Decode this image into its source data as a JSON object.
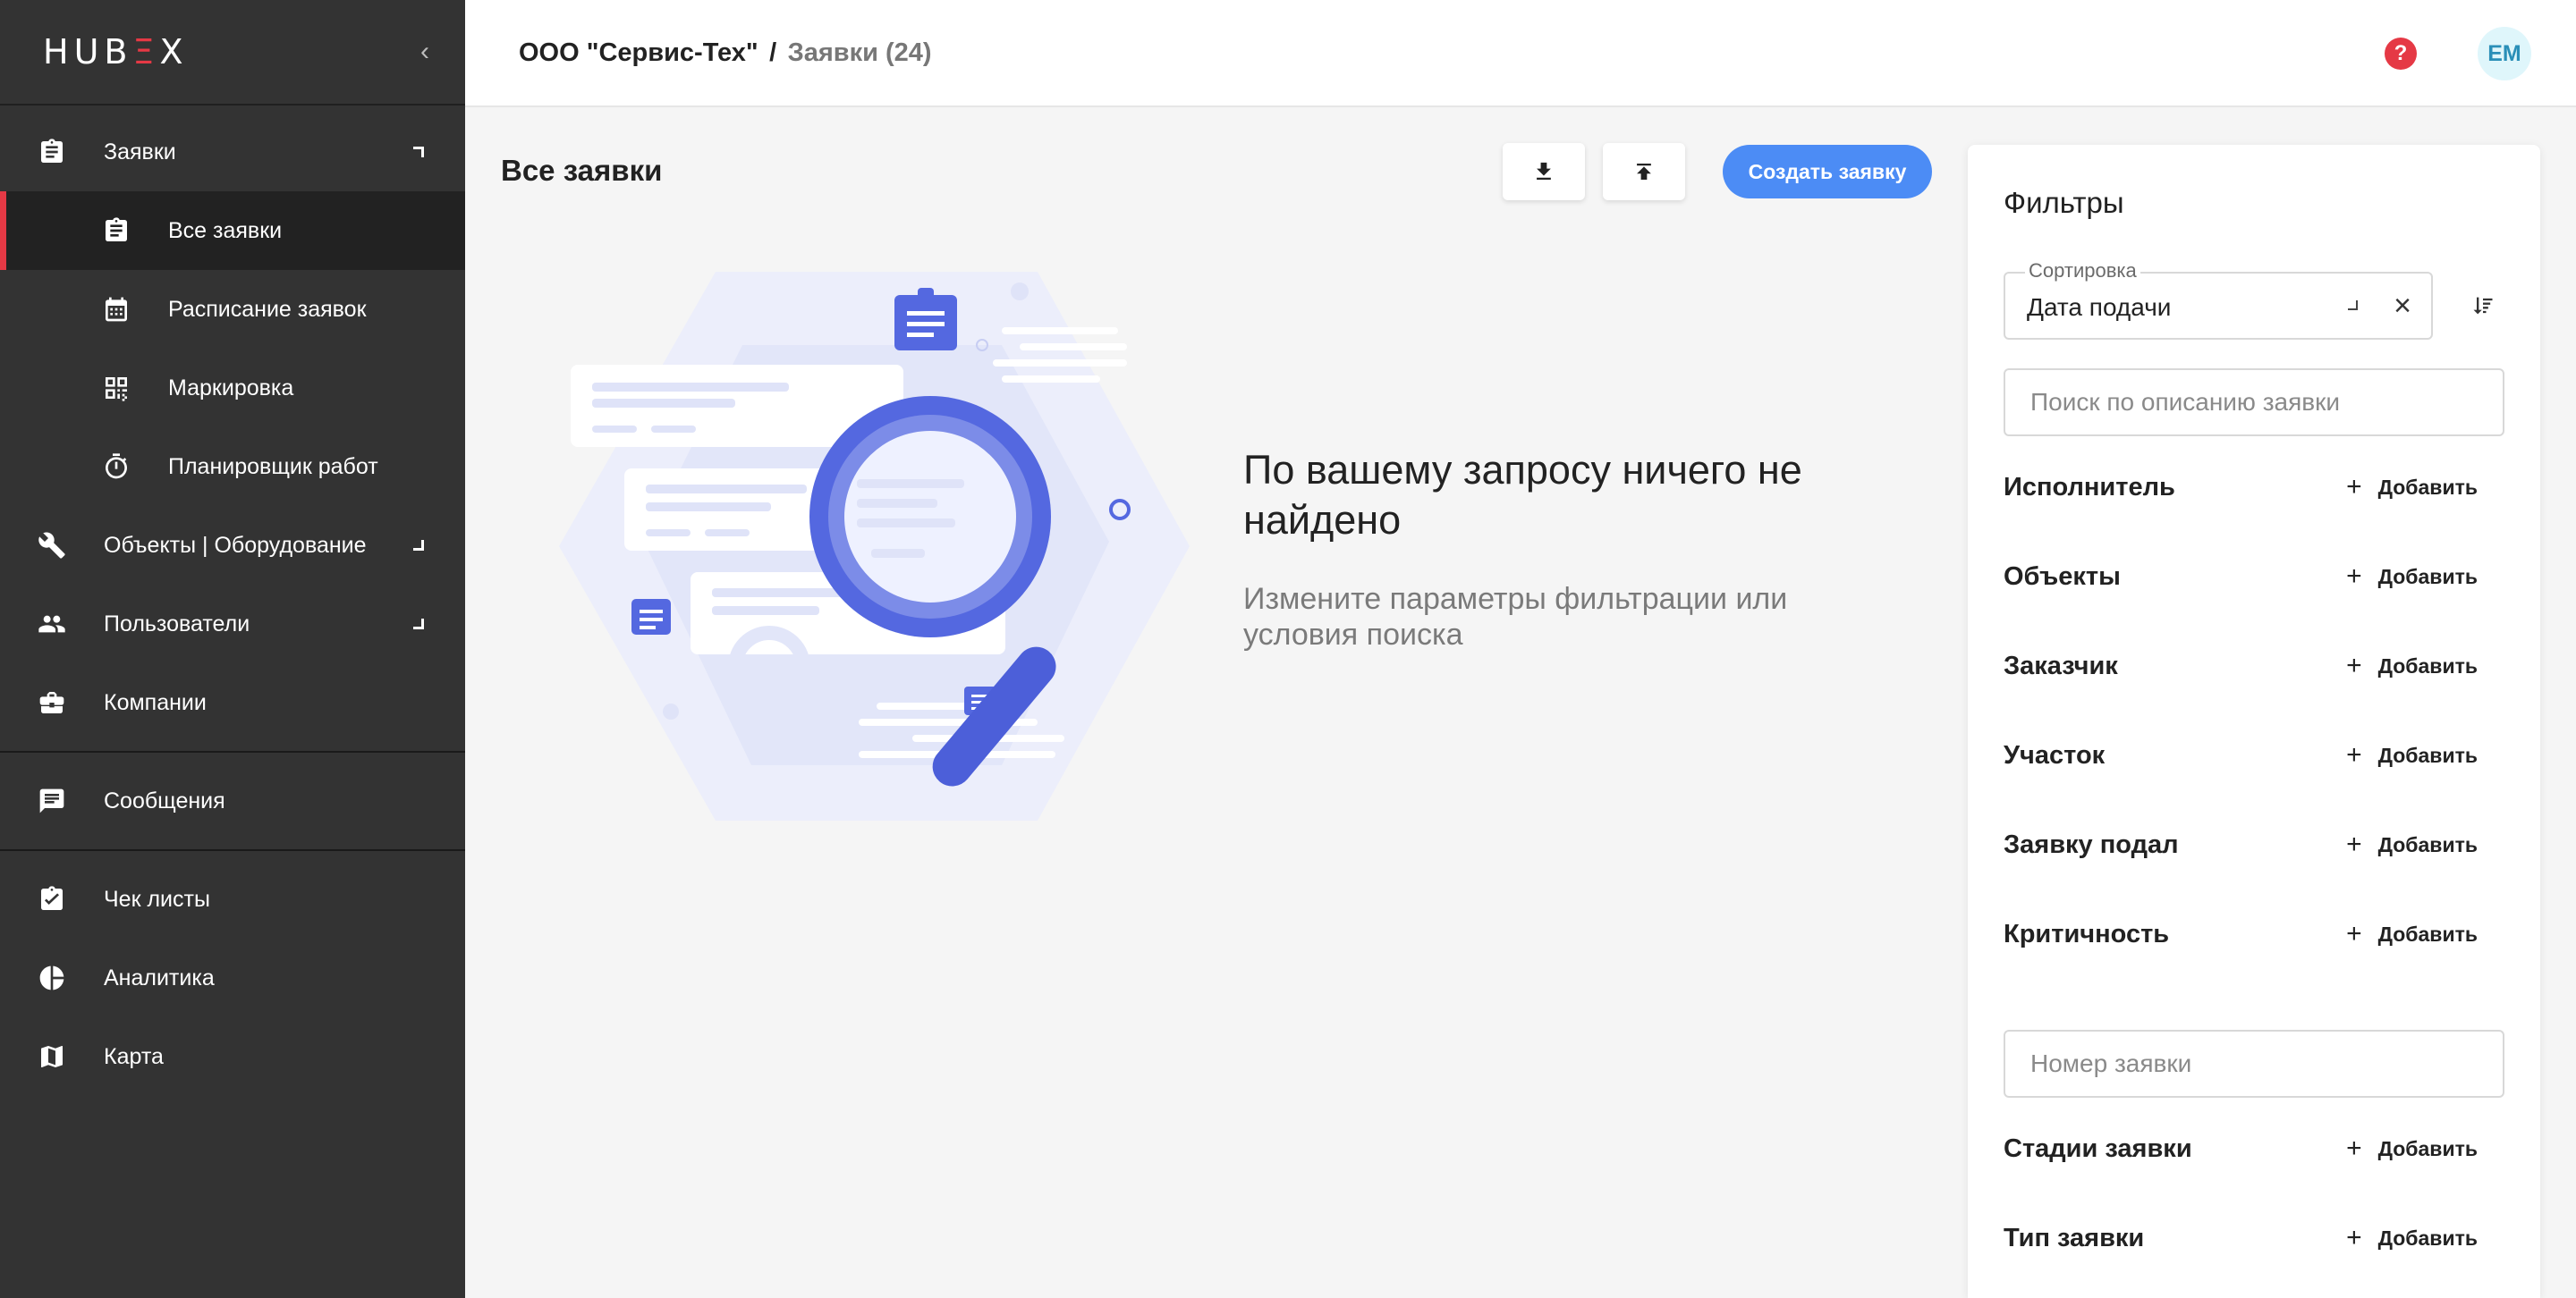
{
  "app": {
    "logo_left": "HUB",
    "logo_accent": "Ξ",
    "logo_right": "X",
    "collapse_icon": "‹"
  },
  "sidebar": {
    "items": [
      {
        "label": "Заявки",
        "icon": "clipboard-icon"
      },
      {
        "label": "Все заявки",
        "icon": "clipboard-icon"
      },
      {
        "label": "Расписание заявок",
        "icon": "calendar-icon"
      },
      {
        "label": "Маркировка",
        "icon": "qr-code-icon"
      },
      {
        "label": "Планировщик работ",
        "icon": "timer-icon"
      },
      {
        "label": "Объекты | Оборудование",
        "icon": "wrench-icon"
      },
      {
        "label": "Пользователи",
        "icon": "users-icon"
      },
      {
        "label": "Компании",
        "icon": "briefcase-icon"
      },
      {
        "label": "Сообщения",
        "icon": "chat-icon"
      },
      {
        "label": "Чек листы",
        "icon": "checklist-icon"
      },
      {
        "label": "Аналитика",
        "icon": "pie-chart-icon"
      },
      {
        "label": "Карта",
        "icon": "map-icon"
      }
    ]
  },
  "header": {
    "company": "ООО \"Сервис-Тех\"",
    "separator": "/",
    "section": "Заявки (24)",
    "help": "?",
    "avatar": "EM"
  },
  "main": {
    "title": "Все заявки",
    "create_button": "Создать заявку",
    "empty_title": "По вашему запросу ничего не найдено",
    "empty_subtitle": "Измените параметры фильтрации или условия поиска"
  },
  "filters": {
    "title": "Фильтры",
    "sort_label": "Сортировка",
    "sort_value": "Дата подачи",
    "search_placeholder": "Поиск по описанию заявки",
    "number_placeholder": "Номер заявки",
    "add_label": "Добавить",
    "groups": [
      "Исполнитель",
      "Объекты",
      "Заказчик",
      "Участок",
      "Заявку подал",
      "Критичность",
      "Стадии заявки",
      "Тип заявки"
    ]
  },
  "colors": {
    "sidebar_bg": "#333333",
    "accent_red": "#e53945",
    "primary_blue": "#4c8cf5",
    "illustration_blue": "#5468e0"
  }
}
